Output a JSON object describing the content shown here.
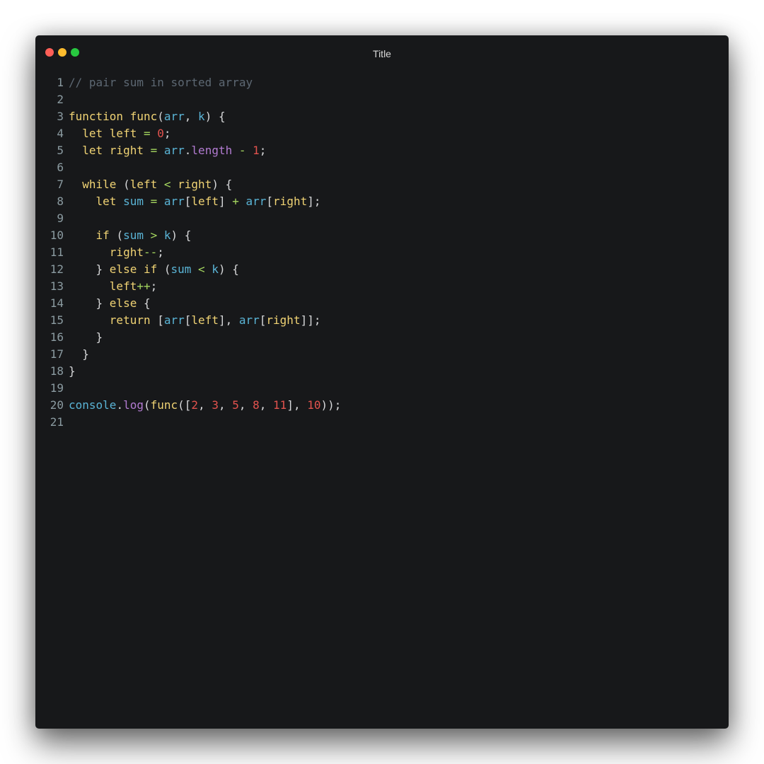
{
  "window": {
    "title": "Title"
  },
  "colors": {
    "background": "#17181a",
    "comment": "#5d6873",
    "keyword": "#f0d374",
    "variable": "#5ab4d6",
    "property": "#b27bd1",
    "number": "#e3534e",
    "operator": "#a5d65f",
    "punctuation": "#d7d8da",
    "line_number": "#8b9ba1"
  },
  "editor": {
    "lines": [
      {
        "number": "1",
        "tokens": [
          {
            "t": "// pair sum in sorted array",
            "c": "comment"
          }
        ]
      },
      {
        "number": "2",
        "tokens": []
      },
      {
        "number": "3",
        "tokens": [
          {
            "t": "function ",
            "c": "keyword"
          },
          {
            "t": "func",
            "c": "func"
          },
          {
            "t": "(",
            "c": "punct"
          },
          {
            "t": "arr",
            "c": "var"
          },
          {
            "t": ", ",
            "c": "punct"
          },
          {
            "t": "k",
            "c": "var"
          },
          {
            "t": ") {",
            "c": "punct"
          }
        ]
      },
      {
        "number": "4",
        "tokens": [
          {
            "t": "  let ",
            "c": "keyword"
          },
          {
            "t": "left",
            "c": "ident"
          },
          {
            "t": " = ",
            "c": "op"
          },
          {
            "t": "0",
            "c": "num"
          },
          {
            "t": ";",
            "c": "punct"
          }
        ]
      },
      {
        "number": "5",
        "tokens": [
          {
            "t": "  let ",
            "c": "keyword"
          },
          {
            "t": "right",
            "c": "ident"
          },
          {
            "t": " = ",
            "c": "op"
          },
          {
            "t": "arr",
            "c": "var"
          },
          {
            "t": ".",
            "c": "punct"
          },
          {
            "t": "length",
            "c": "prop"
          },
          {
            "t": " - ",
            "c": "op"
          },
          {
            "t": "1",
            "c": "num"
          },
          {
            "t": ";",
            "c": "punct"
          }
        ]
      },
      {
        "number": "6",
        "tokens": []
      },
      {
        "number": "7",
        "tokens": [
          {
            "t": "  while ",
            "c": "keyword"
          },
          {
            "t": "(",
            "c": "punct"
          },
          {
            "t": "left",
            "c": "ident"
          },
          {
            "t": " < ",
            "c": "op"
          },
          {
            "t": "right",
            "c": "ident"
          },
          {
            "t": ") {",
            "c": "punct"
          }
        ]
      },
      {
        "number": "8",
        "tokens": [
          {
            "t": "    let ",
            "c": "keyword"
          },
          {
            "t": "sum",
            "c": "var"
          },
          {
            "t": " = ",
            "c": "op"
          },
          {
            "t": "arr",
            "c": "var"
          },
          {
            "t": "[",
            "c": "punct"
          },
          {
            "t": "left",
            "c": "ident"
          },
          {
            "t": "]",
            "c": "punct"
          },
          {
            "t": " + ",
            "c": "op"
          },
          {
            "t": "arr",
            "c": "var"
          },
          {
            "t": "[",
            "c": "punct"
          },
          {
            "t": "right",
            "c": "ident"
          },
          {
            "t": "];",
            "c": "punct"
          }
        ]
      },
      {
        "number": "9",
        "tokens": []
      },
      {
        "number": "10",
        "tokens": [
          {
            "t": "    if ",
            "c": "keyword"
          },
          {
            "t": "(",
            "c": "punct"
          },
          {
            "t": "sum",
            "c": "var"
          },
          {
            "t": " > ",
            "c": "op"
          },
          {
            "t": "k",
            "c": "var"
          },
          {
            "t": ") {",
            "c": "punct"
          }
        ]
      },
      {
        "number": "11",
        "tokens": [
          {
            "t": "      right",
            "c": "ident"
          },
          {
            "t": "--",
            "c": "op"
          },
          {
            "t": ";",
            "c": "punct"
          }
        ]
      },
      {
        "number": "12",
        "tokens": [
          {
            "t": "    } ",
            "c": "punct"
          },
          {
            "t": "else if ",
            "c": "keyword"
          },
          {
            "t": "(",
            "c": "punct"
          },
          {
            "t": "sum",
            "c": "var"
          },
          {
            "t": " < ",
            "c": "op"
          },
          {
            "t": "k",
            "c": "var"
          },
          {
            "t": ") {",
            "c": "punct"
          }
        ]
      },
      {
        "number": "13",
        "tokens": [
          {
            "t": "      left",
            "c": "ident"
          },
          {
            "t": "++",
            "c": "op"
          },
          {
            "t": ";",
            "c": "punct"
          }
        ]
      },
      {
        "number": "14",
        "tokens": [
          {
            "t": "    } ",
            "c": "punct"
          },
          {
            "t": "else",
            "c": "keyword"
          },
          {
            "t": " {",
            "c": "punct"
          }
        ]
      },
      {
        "number": "15",
        "tokens": [
          {
            "t": "      return ",
            "c": "keyword"
          },
          {
            "t": "[",
            "c": "punct"
          },
          {
            "t": "arr",
            "c": "var"
          },
          {
            "t": "[",
            "c": "punct"
          },
          {
            "t": "left",
            "c": "ident"
          },
          {
            "t": "], ",
            "c": "punct"
          },
          {
            "t": "arr",
            "c": "var"
          },
          {
            "t": "[",
            "c": "punct"
          },
          {
            "t": "right",
            "c": "ident"
          },
          {
            "t": "]];",
            "c": "punct"
          }
        ]
      },
      {
        "number": "16",
        "tokens": [
          {
            "t": "    }",
            "c": "punct"
          }
        ]
      },
      {
        "number": "17",
        "tokens": [
          {
            "t": "  }",
            "c": "punct"
          }
        ]
      },
      {
        "number": "18",
        "tokens": [
          {
            "t": "}",
            "c": "punct"
          }
        ]
      },
      {
        "number": "19",
        "tokens": []
      },
      {
        "number": "20",
        "tokens": [
          {
            "t": "console",
            "c": "var"
          },
          {
            "t": ".",
            "c": "punct"
          },
          {
            "t": "log",
            "c": "prop"
          },
          {
            "t": "(",
            "c": "punct"
          },
          {
            "t": "func",
            "c": "func"
          },
          {
            "t": "([",
            "c": "punct"
          },
          {
            "t": "2",
            "c": "num"
          },
          {
            "t": ", ",
            "c": "punct"
          },
          {
            "t": "3",
            "c": "num"
          },
          {
            "t": ", ",
            "c": "punct"
          },
          {
            "t": "5",
            "c": "num"
          },
          {
            "t": ", ",
            "c": "punct"
          },
          {
            "t": "8",
            "c": "num"
          },
          {
            "t": ", ",
            "c": "punct"
          },
          {
            "t": "11",
            "c": "num"
          },
          {
            "t": "], ",
            "c": "punct"
          },
          {
            "t": "10",
            "c": "num"
          },
          {
            "t": "));",
            "c": "punct"
          }
        ]
      },
      {
        "number": "21",
        "tokens": []
      }
    ]
  }
}
